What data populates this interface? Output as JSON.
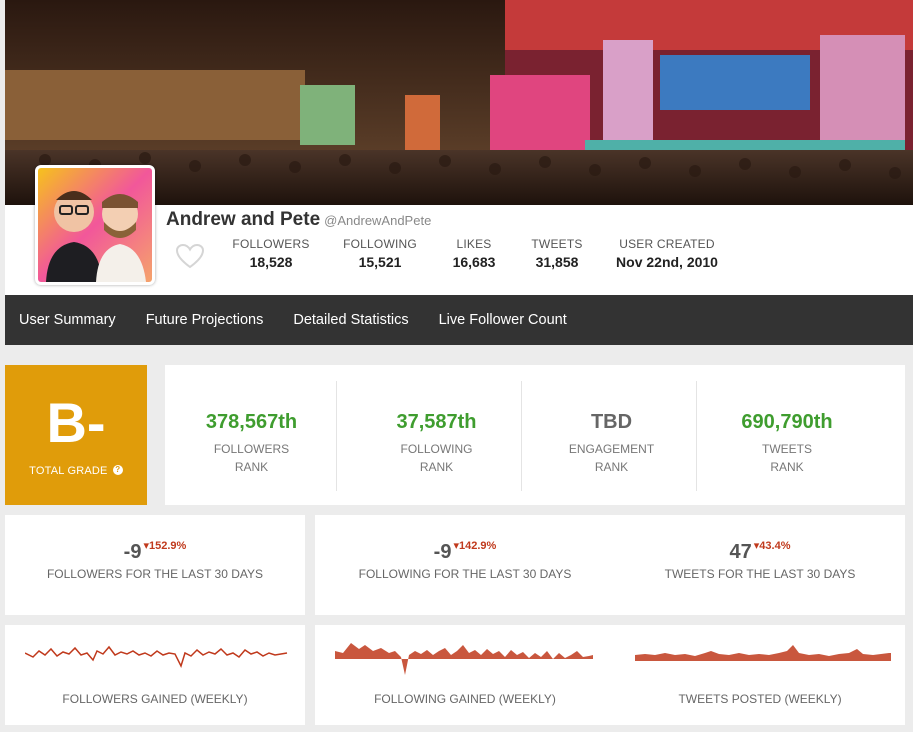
{
  "profile": {
    "name": "Andrew and Pete",
    "handle": "@AndrewAndPete",
    "stats": [
      {
        "label": "FOLLOWERS",
        "value": "18,528"
      },
      {
        "label": "FOLLOWING",
        "value": "15,521"
      },
      {
        "label": "LIKES",
        "value": "16,683"
      },
      {
        "label": "TWEETS",
        "value": "31,858"
      },
      {
        "label": "USER CREATED",
        "value": "Nov 22nd, 2010"
      }
    ]
  },
  "nav": [
    "User Summary",
    "Future Projections",
    "Detailed Statistics",
    "Live Follower Count"
  ],
  "grade": {
    "letter": "B-",
    "label": "TOTAL GRADE",
    "help": "?"
  },
  "ranks": [
    {
      "value": "378,567th",
      "label1": "FOLLOWERS",
      "label2": "RANK"
    },
    {
      "value": "37,587th",
      "label1": "FOLLOWING",
      "label2": "RANK"
    },
    {
      "value": "TBD",
      "label1": "ENGAGEMENT",
      "label2": "RANK"
    },
    {
      "value": "690,790th",
      "label1": "TWEETS",
      "label2": "RANK"
    }
  ],
  "changes": [
    {
      "value": "-9",
      "pct": "152.9%",
      "label": "FOLLOWERS FOR THE LAST 30 DAYS"
    },
    {
      "value": "-9",
      "pct": "142.9%",
      "label": "FOLLOWING FOR THE LAST 30 DAYS"
    },
    {
      "value": "47",
      "pct": "43.4%",
      "label": "TWEETS FOR THE LAST 30 DAYS"
    }
  ],
  "sparklines": [
    {
      "label": "FOLLOWERS GAINED (WEEKLY)"
    },
    {
      "label": "FOLLOWING GAINED (WEEKLY)"
    },
    {
      "label": "TWEETS POSTED (WEEKLY)"
    }
  ],
  "colors": {
    "accent_grade": "#e09c0a",
    "rank_green": "#3f9d2f",
    "negative_red": "#c0391c",
    "nav_bg": "#333333"
  },
  "icons": {
    "heart": "heart-icon",
    "help": "question-icon",
    "down_arrow": "triangle-down-icon"
  }
}
